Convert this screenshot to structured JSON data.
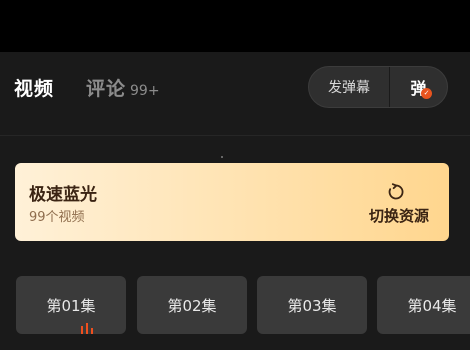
{
  "tabs": {
    "video": "视频",
    "comment": "评论",
    "comment_count": "99+"
  },
  "danmaku": {
    "send_label": "发弹幕",
    "toggle_glyph": "弹",
    "toggle_badge": "✓"
  },
  "source": {
    "title": "极速蓝光",
    "subtitle": "99个视频",
    "switch_label": "切换资源"
  },
  "episodes": [
    "第01集",
    "第02集",
    "第03集",
    "第04集"
  ],
  "colors": {
    "accent": "#ef4f1e",
    "card_start": "#fff1d8",
    "card_end": "#ffd68e"
  },
  "icons": {
    "switch": "refresh-icon",
    "playing": "playing-bars-icon"
  }
}
